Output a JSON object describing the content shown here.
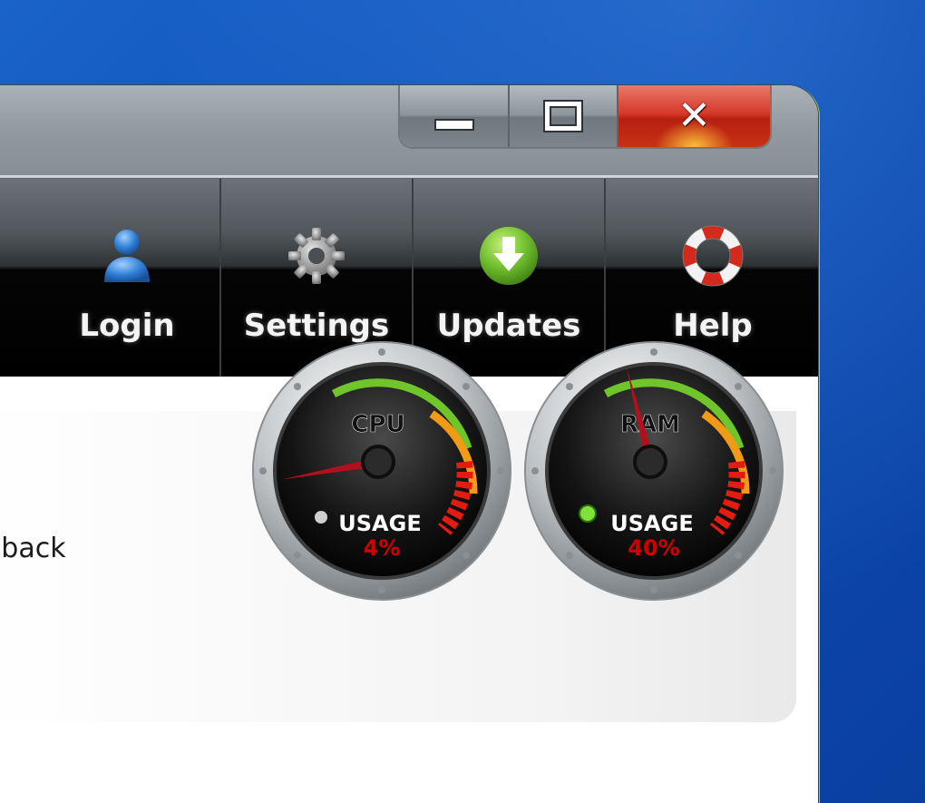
{
  "window": {
    "caption_buttons": {
      "minimize": "minimize-icon",
      "maximize": "maximize-icon",
      "close_glyph": "✕"
    }
  },
  "toolbar": {
    "items": [
      {
        "label": "Login",
        "icon": "user-icon"
      },
      {
        "label": "Settings",
        "icon": "gear-icon"
      },
      {
        "label": "Updates",
        "icon": "download-arrow-icon"
      },
      {
        "label": "Help",
        "icon": "lifebuoy-icon"
      }
    ]
  },
  "content": {
    "welcome_text": "t back"
  },
  "gauges": {
    "cpu": {
      "title": "CPU",
      "caption": "USAGE",
      "value_label": "4%",
      "value": 4
    },
    "ram": {
      "title": "RAM",
      "caption": "USAGE",
      "value_label": "40%",
      "value": 40
    }
  },
  "colors": {
    "accent_red": "#d10000",
    "close_red": "#c62814",
    "update_green": "#6fbe2e",
    "user_blue": "#2f7fd6"
  }
}
